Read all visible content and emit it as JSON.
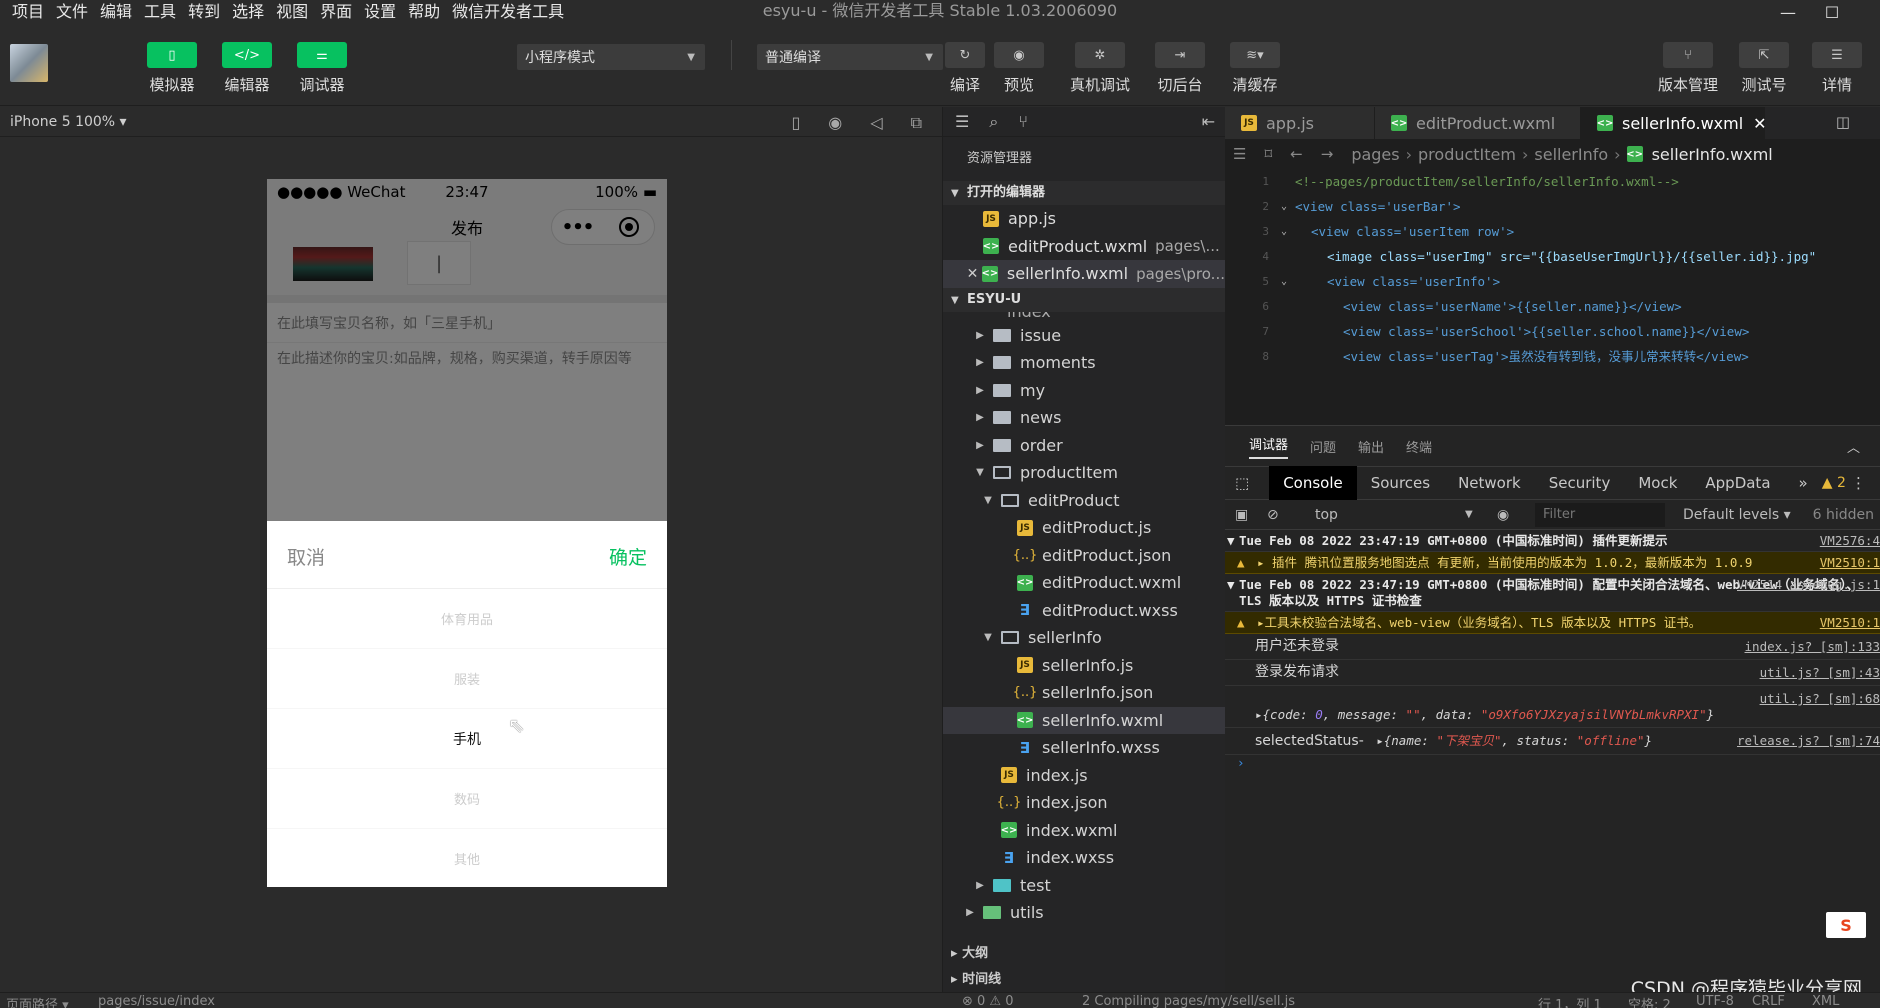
{
  "menubar": {
    "items": [
      "项目",
      "文件",
      "编辑",
      "工具",
      "转到",
      "选择",
      "视图",
      "界面",
      "设置",
      "帮助",
      "微信开发者工具"
    ],
    "title": "esyu-u - 微信开发者工具 Stable 1.03.2006090",
    "minimize": "—",
    "maximize": "☐"
  },
  "toolbar": {
    "simulator": "模拟器",
    "editor": "编辑器",
    "debugger": "调试器",
    "mode_select": "小程序模式",
    "compile_select": "普通编译",
    "compile": "编译",
    "preview": "预览",
    "real_debug": "真机调试",
    "background": "切后台",
    "clear_cache": "清缓存",
    "version": "版本管理",
    "test_account": "测试号",
    "details": "详情"
  },
  "simulator": {
    "device": "iPhone 5 100% ▾",
    "status_left": "●●●●● WeChat",
    "status_time": "23:47",
    "status_right": "100%",
    "nav_title": "发布",
    "field_title_placeholder": "在此填写宝贝名称，如「三星手机」",
    "field_desc_placeholder": "在此描述你的宝贝:如品牌，规格，购买渠道，转手原因等",
    "picker_cancel": "取消",
    "picker_confirm": "确定",
    "picker_options": [
      "体育用品",
      "服装",
      "手机",
      "数码",
      "其他"
    ],
    "picker_selected": "手机"
  },
  "explorer": {
    "title": "资源管理器",
    "open_editors_label": "打开的编辑器",
    "open_editors": [
      {
        "name": "app.js",
        "path": ""
      },
      {
        "name": "editProduct.wxml",
        "path": "pages\\..."
      },
      {
        "name": "sellerInfo.wxml",
        "path": "pages\\pro..."
      }
    ],
    "project_label": "ESYU-U",
    "clipped_item": "index",
    "tree": [
      {
        "name": "issue"
      },
      {
        "name": "moments"
      },
      {
        "name": "my"
      },
      {
        "name": "news"
      },
      {
        "name": "order"
      },
      {
        "name": "productItem"
      },
      {
        "name": "editProduct"
      },
      {
        "name": "editProduct.js"
      },
      {
        "name": "editProduct.json"
      },
      {
        "name": "editProduct.wxml"
      },
      {
        "name": "editProduct.wxss"
      },
      {
        "name": "sellerInfo"
      },
      {
        "name": "sellerInfo.js"
      },
      {
        "name": "sellerInfo.json"
      },
      {
        "name": "sellerInfo.wxml"
      },
      {
        "name": "sellerInfo.wxss"
      },
      {
        "name": "index.js"
      },
      {
        "name": "index.json"
      },
      {
        "name": "index.wxml"
      },
      {
        "name": "index.wxss"
      },
      {
        "name": "test"
      },
      {
        "name": "utils"
      }
    ],
    "outline": "大纲",
    "timeline": "时间线"
  },
  "editor": {
    "tabs": [
      "app.js",
      "editProduct.wxml",
      "sellerInfo.wxml"
    ],
    "breadcrumb": [
      "pages",
      "productItem",
      "sellerInfo",
      "sellerInfo.wxml"
    ],
    "code": [
      "<!--pages/productItem/sellerInfo/sellerInfo.wxml-->",
      "<view class='userBar'>",
      "<view class='userItem row'>",
      "<image class=\"userImg\" src=\"{{baseUserImgUrl}}/{{seller.id}}.jpg\"",
      "<view class='userInfo'>",
      "<view class='userName'>{{seller.name}}</view>",
      "<view class='userSchool'>{{seller.school.name}}</view>",
      "<view class='userTag'>虽然没有转到钱，没事儿常来转转</view>"
    ]
  },
  "debugger": {
    "tabs": [
      "调试器",
      "问题",
      "输出",
      "终端"
    ],
    "panels": [
      "Console",
      "Sources",
      "Network",
      "Security",
      "Mock",
      "AppData"
    ],
    "more": "»",
    "warn_count": "2",
    "context": "top",
    "filter_placeholder": "Filter",
    "levels": "Default levels ▾",
    "hidden": "6 hidden",
    "logs": {
      "g1_title": "Tue Feb 08 2022 23:47:19 GMT+0800 (中国标准时间) 插件更新提示",
      "g1_ref": "VM2576:4",
      "w1": "▸ 插件 腾讯位置服务地图选点 有更新，当前使用的版本为 1.0.2，最新版本为 1.0.9",
      "w1_ref": "VM2510:1",
      "g2_title": "Tue Feb 08 2022 23:47:19 GMT+0800 (中国标准时间) 配置中关闭合法域名、web-view（业务域名）、TLS 版本以及 HTTPS 证书检查",
      "g2_ref": "VM2514 asdebug.js:1",
      "w2": "▸工具未校验合法域名、web-view（业务域名）、TLS 版本以及 HTTPS 证书。",
      "w2_ref": "VM2510:1",
      "l1": "用户还未登录",
      "l1_ref": "index.js? [sm]:133",
      "l2": "登录发布请求",
      "l2_ref": "util.js? [sm]:43",
      "l3_ref": "util.js? [sm]:68",
      "l3_code": "0",
      "l3_message": "\"\"",
      "l3_data": "\"o9Xfo6YJXzyajsilVNYbLmkvRPXI\"",
      "l4_label": "selectedStatus-",
      "l4_name": "\"下架宝贝\"",
      "l4_status": "\"offline\"",
      "l4_ref": "release.js? [sm]:74"
    }
  },
  "statusbar": {
    "page_path_label": "页面路径 ▾",
    "page_path": "pages/issue/index",
    "problems": "⊗ 0 ⚠ 0",
    "compiling": "2 Compiling pages/my/sell/sell.js",
    "cursor": "行 1，列 1",
    "spaces": "空格: 2",
    "encoding": "UTF-8",
    "eol": "CRLF",
    "lang": "XML"
  },
  "watermark": "CSDN @程序猿毕业分享网",
  "colors": {
    "accent": "#07c160",
    "warning": "#e8b93a"
  }
}
